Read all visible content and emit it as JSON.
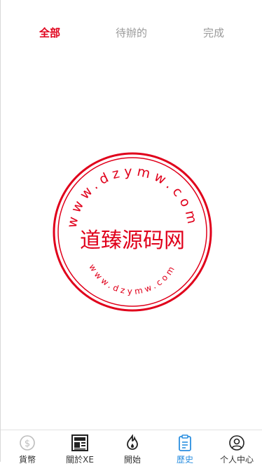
{
  "tabs": [
    {
      "label": "全部",
      "active": true
    },
    {
      "label": "待辦的",
      "active": false
    },
    {
      "label": "完成",
      "active": false
    }
  ],
  "watermark": {
    "text_center": "道臻源码网",
    "text_ring": "www.dzymw.com",
    "color": "#e0001b"
  },
  "bottom_nav": [
    {
      "label": "貨幣",
      "icon": "dollar-circle-icon",
      "active": false
    },
    {
      "label": "關於XE",
      "icon": "newspaper-icon",
      "active": false
    },
    {
      "label": "開始",
      "icon": "flame-icon",
      "active": false
    },
    {
      "label": "歷史",
      "icon": "clipboard-icon",
      "active": true
    },
    {
      "label": "个人中心",
      "icon": "user-circle-icon",
      "active": false
    }
  ],
  "colors": {
    "accent": "#e0001b",
    "nav_active": "#2b8fe0",
    "inactive": "#9a9a9a"
  }
}
